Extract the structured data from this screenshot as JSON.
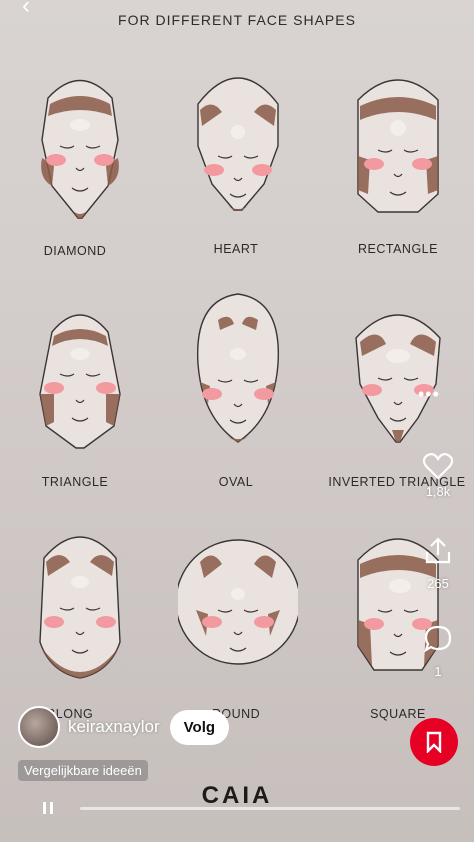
{
  "header": {
    "subtitle": "FOR DIFFERENT FACE SHAPES"
  },
  "faces": [
    {
      "label": "DIAMOND"
    },
    {
      "label": "HEART"
    },
    {
      "label": "RECTANGLE"
    },
    {
      "label": "TRIANGLE"
    },
    {
      "label": "OVAL"
    },
    {
      "label": "INVERTED TRIANGLE"
    },
    {
      "label": "OBLONG"
    },
    {
      "label": "ROUND"
    },
    {
      "label": "SQUARE"
    }
  ],
  "actions": {
    "likes": "1,8k",
    "shares": "265",
    "comments": "1"
  },
  "user": {
    "username": "keiraxnaylor",
    "follow_label": "Volg"
  },
  "similar_label": "Vergelijkbare ideeën",
  "brand": "CAIA",
  "colors": {
    "contour": "#8a5a48",
    "highlight": "#f3eeea",
    "blush": "#f29aa0",
    "save_button": "#e60023"
  },
  "icons": [
    "back-arrow-icon",
    "more-icon",
    "heart-icon",
    "share-icon",
    "comment-icon",
    "bookmark-icon",
    "pause-icon"
  ]
}
